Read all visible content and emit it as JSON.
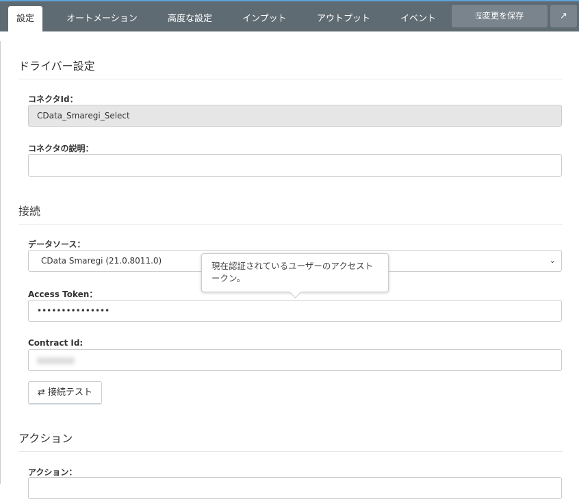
{
  "tabs": [
    {
      "label": "設定"
    },
    {
      "label": "オートメーション"
    },
    {
      "label": "高度な設定"
    },
    {
      "label": "インプット"
    },
    {
      "label": "アウトプット"
    },
    {
      "label": "イベント"
    }
  ],
  "save_label": "変更を保存",
  "sections": {
    "driver": "ドライバー設定",
    "connection": "接続",
    "action": "アクション"
  },
  "fields": {
    "connector_id_label": "コネクタId：",
    "connector_id_value": "CData_Smaregi_Select",
    "desc_label": "コネクタの説明：",
    "desc_value": "",
    "datasource_label": "データソース：",
    "datasource_value": "CData Smaregi (21.0.8011.0)",
    "token_label": "Access Token：",
    "token_value": "•••••••••••••••",
    "contract_label": "Contract Id:",
    "action_label": "アクション："
  },
  "test_label": "接続テスト",
  "tooltip": "現在認証されているユーザーのアクセストークン。"
}
